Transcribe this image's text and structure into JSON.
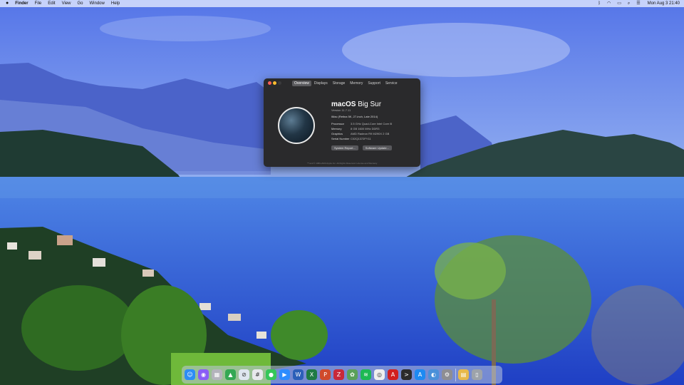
{
  "menubar": {
    "apple_icon": "apple-logo-icon",
    "app_name": "Finder",
    "menus": [
      "File",
      "Edit",
      "View",
      "Go",
      "Window",
      "Help"
    ],
    "status_icons": [
      "bluetooth-icon",
      "wifi-icon",
      "battery-icon",
      "search-icon",
      "control-center-icon"
    ],
    "clock": "Mon Aug 3  21:40"
  },
  "about_window": {
    "tabs": [
      "Overview",
      "Displays",
      "Storage",
      "Memory",
      "Support",
      "Service"
    ],
    "active_tab": "Overview",
    "os_name": "macOS",
    "os_release": "Big Sur",
    "version": "Version 11.7.11",
    "model": "iMac (Retina 5K, 27-inch, Late 2014)",
    "specs": [
      {
        "label": "Processor",
        "value": "3.5 GHz Quad-Core Intel Core i5"
      },
      {
        "label": "Memory",
        "value": "8 GB 1600 MHz DDR3"
      },
      {
        "label": "Graphics",
        "value": "AMD Radeon R9 M290X 2 GB"
      },
      {
        "label": "Serial Number",
        "value": "C02Q1372FY11"
      }
    ],
    "buttons": {
      "system_report": "System Report...",
      "software_update": "Software Update..."
    },
    "copyright": "™ and © 1983-2020 Apple Inc. All Rights Reserved. License and Warranty"
  },
  "dock": {
    "apps": [
      {
        "name": "finder-icon",
        "glyph": "☺",
        "color": "#2d8df5"
      },
      {
        "name": "siri-icon",
        "glyph": "◉",
        "color": "#8a5cf6"
      },
      {
        "name": "launchpad-icon",
        "glyph": "▦",
        "color": "#b4b4bc"
      },
      {
        "name": "google-drive-icon",
        "glyph": "▲",
        "color": "#34a853"
      },
      {
        "name": "safari-icon",
        "glyph": "⊘",
        "color": "#dfe6ef"
      },
      {
        "name": "slack-icon",
        "glyph": "#",
        "color": "#e8e8ec"
      },
      {
        "name": "messages-icon",
        "glyph": "●",
        "color": "#35c759"
      },
      {
        "name": "zoom-icon",
        "glyph": "▶",
        "color": "#2d8cff"
      },
      {
        "name": "word-icon",
        "glyph": "W",
        "color": "#2b5fb8"
      },
      {
        "name": "excel-icon",
        "glyph": "X",
        "color": "#1f7a44"
      },
      {
        "name": "powerpoint-icon",
        "glyph": "P",
        "color": "#d04a2b"
      },
      {
        "name": "pdf-expert-icon",
        "glyph": "Z",
        "color": "#c8283a"
      },
      {
        "name": "photo-app-icon",
        "glyph": "✿",
        "color": "#5aa05a"
      },
      {
        "name": "spotify-icon",
        "glyph": "≋",
        "color": "#1db954"
      },
      {
        "name": "tower-icon",
        "glyph": "◎",
        "color": "#efefef"
      },
      {
        "name": "acrobat-icon",
        "glyph": "A",
        "color": "#d21f1f"
      },
      {
        "name": "terminal-icon",
        "glyph": ">",
        "color": "#2b2b2b"
      },
      {
        "name": "app-store-icon",
        "glyph": "A",
        "color": "#1d8af2"
      },
      {
        "name": "screenflow-icon",
        "glyph": "◐",
        "color": "#4a90d9"
      },
      {
        "name": "settings-icon",
        "glyph": "⚙",
        "color": "#8e8e93"
      }
    ],
    "utilities": [
      {
        "name": "downloads-folder-icon",
        "glyph": "▤",
        "color": "#e8b94a"
      },
      {
        "name": "trash-icon",
        "glyph": "▯",
        "color": "#9da3aa"
      }
    ]
  }
}
